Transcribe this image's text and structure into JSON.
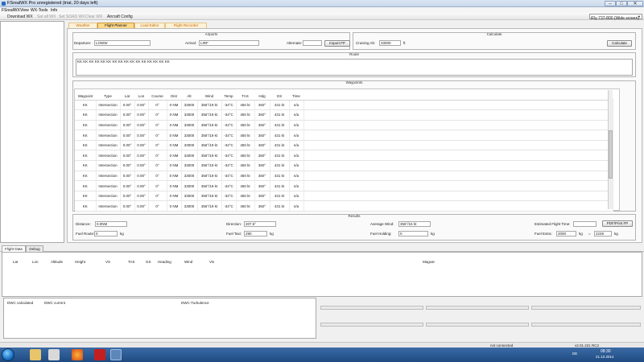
{
  "window": {
    "title": "FSrealWX Pro unregistered (trial, 20 days left)",
    "minimize": "–",
    "maximize": "□",
    "close": "✕"
  },
  "menu": [
    "FSrealWX",
    "View",
    "WX-Tools",
    "Info"
  ],
  "toolbar": {
    "items": [
      {
        "label": "Download WX",
        "enabled": true
      },
      {
        "label": "Set all WX",
        "enabled": false
      },
      {
        "label": "Set SOAD WX",
        "enabled": false
      },
      {
        "label": "Clear WX",
        "enabled": false
      },
      {
        "label": "Aircraft Config",
        "enabled": true
      }
    ],
    "aircraft": "iFly 737-800 (Wide screen)"
  },
  "tabs": [
    "Weather",
    "Flight Planner",
    "Load Editor",
    "Flight Recorder"
  ],
  "active_tab": 1,
  "airports": {
    "title": "Airports",
    "departure_label": "Departure:",
    "departure": "LOWW",
    "arrival_label": "Arrival:",
    "arrival": "LIRF",
    "alternate_label": "Alternate:",
    "alternate": "",
    "import_button": "Import FP"
  },
  "calculate": {
    "title": "Calculate",
    "cruising_label": "Cruising Alt:",
    "cruising": "33000",
    "cruising_unit": "ft",
    "button": "Calculate"
  },
  "route": {
    "title": "Route",
    "text": "KK KK KK KK KK KK KK KK KK KK KK KK KK KK KK KK"
  },
  "waypoints": {
    "title": "Waypoints",
    "columns": [
      "Waypoint",
      "Type",
      "Lat",
      "Lon",
      "Course",
      "Dist",
      "Alt",
      "Wind",
      "Temp",
      "TAS",
      "Hdg",
      "GS",
      "Time"
    ],
    "rows": [
      [
        "KK",
        "Intersection",
        "0.00°",
        "0.00°",
        "0°",
        "0 NM",
        "33000",
        "356°/19 kt",
        "-34°C",
        "450 kt",
        "360°",
        "431 kt",
        "n/a"
      ],
      [
        "KK",
        "Intersection",
        "0.00°",
        "0.00°",
        "0°",
        "0 NM",
        "33000",
        "356°/19 kt",
        "-34°C",
        "450 kt",
        "360°",
        "431 kt",
        "n/a"
      ],
      [
        "KK",
        "Intersection",
        "0.00°",
        "0.00°",
        "0°",
        "0 NM",
        "33000",
        "356°/19 kt",
        "-34°C",
        "450 kt",
        "360°",
        "431 kt",
        "n/a"
      ],
      [
        "KK",
        "Intersection",
        "0.00°",
        "0.00°",
        "0°",
        "0 NM",
        "33000",
        "356°/19 kt",
        "-34°C",
        "450 kt",
        "360°",
        "431 kt",
        "n/a"
      ],
      [
        "KK",
        "Intersection",
        "0.00°",
        "0.00°",
        "0°",
        "0 NM",
        "33000",
        "356°/19 kt",
        "-34°C",
        "450 kt",
        "360°",
        "431 kt",
        "n/a"
      ],
      [
        "KK",
        "Intersection",
        "0.00°",
        "0.00°",
        "0°",
        "0 NM",
        "33000",
        "356°/19 kt",
        "-34°C",
        "450 kt",
        "360°",
        "431 kt",
        "n/a"
      ],
      [
        "KK",
        "Intersection",
        "0.00°",
        "0.00°",
        "0°",
        "0 NM",
        "33000",
        "356°/19 kt",
        "-34°C",
        "450 kt",
        "360°",
        "431 kt",
        "n/a"
      ],
      [
        "KK",
        "Intersection",
        "0.00°",
        "0.00°",
        "0°",
        "0 NM",
        "33000",
        "356°/19 kt",
        "-34°C",
        "450 kt",
        "360°",
        "431 kt",
        "n/a"
      ],
      [
        "KK",
        "Intersection",
        "0.00°",
        "0.00°",
        "0°",
        "0 NM",
        "33000",
        "356°/19 kt",
        "-34°C",
        "450 kt",
        "360°",
        "431 kt",
        "n/a"
      ],
      [
        "KK",
        "Intersection",
        "0.00°",
        "0.00°",
        "0°",
        "0 NM",
        "33000",
        "356°/19 kt",
        "-34°C",
        "450 kt",
        "360°",
        "431 kt",
        "n/a"
      ],
      [
        "KK",
        "Intersection",
        "0.00°",
        "0.00°",
        "0°",
        "0 NM",
        "33000",
        "356°/19 kt",
        "-34°C",
        "450 kt",
        "360°",
        "431 kt",
        "n/a"
      ]
    ]
  },
  "results": {
    "title": "Results",
    "distance_label": "Distance:",
    "distance": "0.0NM",
    "direction_label": "Direction:",
    "direction": "207.5°",
    "avg_wind_label": "Average Wind:",
    "avg_wind": "356°/16 kt",
    "eft_label": "Estimated Flight Time:",
    "eft": "",
    "pdf_button": "PDF/Print FP",
    "fuel_route_label": "Fuel Route:",
    "fuel_route": "0",
    "fuel_route_unit": "kg",
    "fuel_taxi_label": "Fuel Taxi:",
    "fuel_taxi": "290",
    "fuel_taxi_unit": "kg",
    "fuel_holding_label": "Fuel Holding:",
    "fuel_holding": "0",
    "fuel_holding_unit": "kg",
    "fuel_extra_label": "Fuel Extra:",
    "fuel_extra": "2000",
    "fuel_extra_unit": "kg",
    "fuel_total_eq": "=",
    "fuel_total": "2249",
    "fuel_total_unit": "kg"
  },
  "bottom_tabs": [
    "Flight Data",
    "Debug"
  ],
  "flight_data": {
    "columns": [
      "Lat",
      "Lon",
      "Altitude",
      "Height",
      "VS",
      "TAS",
      "GS",
      "Heading",
      "Wind",
      "Vis"
    ],
    "magvar": "Magvar"
  },
  "dwc": {
    "calculated": "DWC calculated",
    "current": "DWC current",
    "turbulence": "DWC-Turbulence"
  },
  "status": {
    "connection": "not connected",
    "version": "v2.01.221 RC2"
  },
  "taskbar": {
    "lang": "DE",
    "time": "08:30",
    "date": "21.12.2014"
  }
}
